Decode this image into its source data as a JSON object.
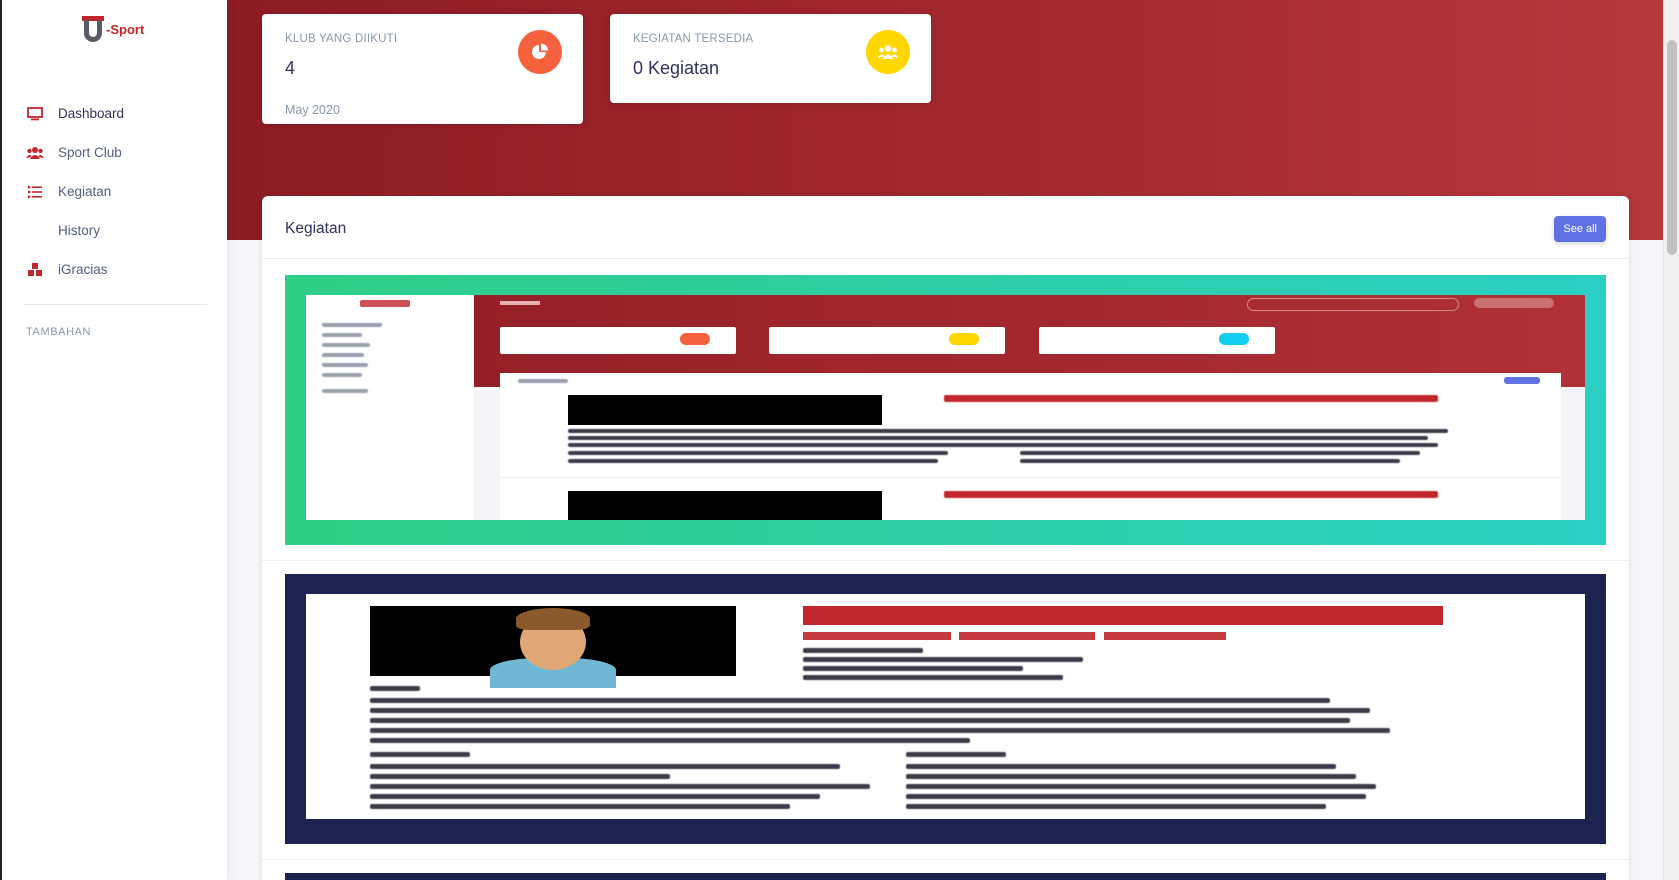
{
  "brand": {
    "name": "-Sport"
  },
  "sidebar": {
    "items": [
      {
        "label": "Dashboard",
        "icon": "monitor-icon"
      },
      {
        "label": "Sport Club",
        "icon": "users-icon"
      },
      {
        "label": "Kegiatan",
        "icon": "list-icon"
      },
      {
        "label": "History",
        "icon": "none"
      },
      {
        "label": "iGracias",
        "icon": "cubes-icon"
      }
    ],
    "section_label": "TAMBAHAN"
  },
  "stats": [
    {
      "title": "KLUB YANG DIIKUTI",
      "value": "4",
      "footer": "May 2020",
      "icon": "pie-chart-icon",
      "color": "#f5603d"
    },
    {
      "title": "KEGIATAN TERSEDIA",
      "value": "0 Kegiatan",
      "icon": "group-icon",
      "color": "#ffd600"
    }
  ],
  "panel": {
    "title": "Kegiatan",
    "see_all": "See all"
  },
  "colors": {
    "accent": "#5e72e4",
    "brand_red": "#c0262b",
    "hero_start": "#8d1c23",
    "hero_end": "#b5383b"
  }
}
